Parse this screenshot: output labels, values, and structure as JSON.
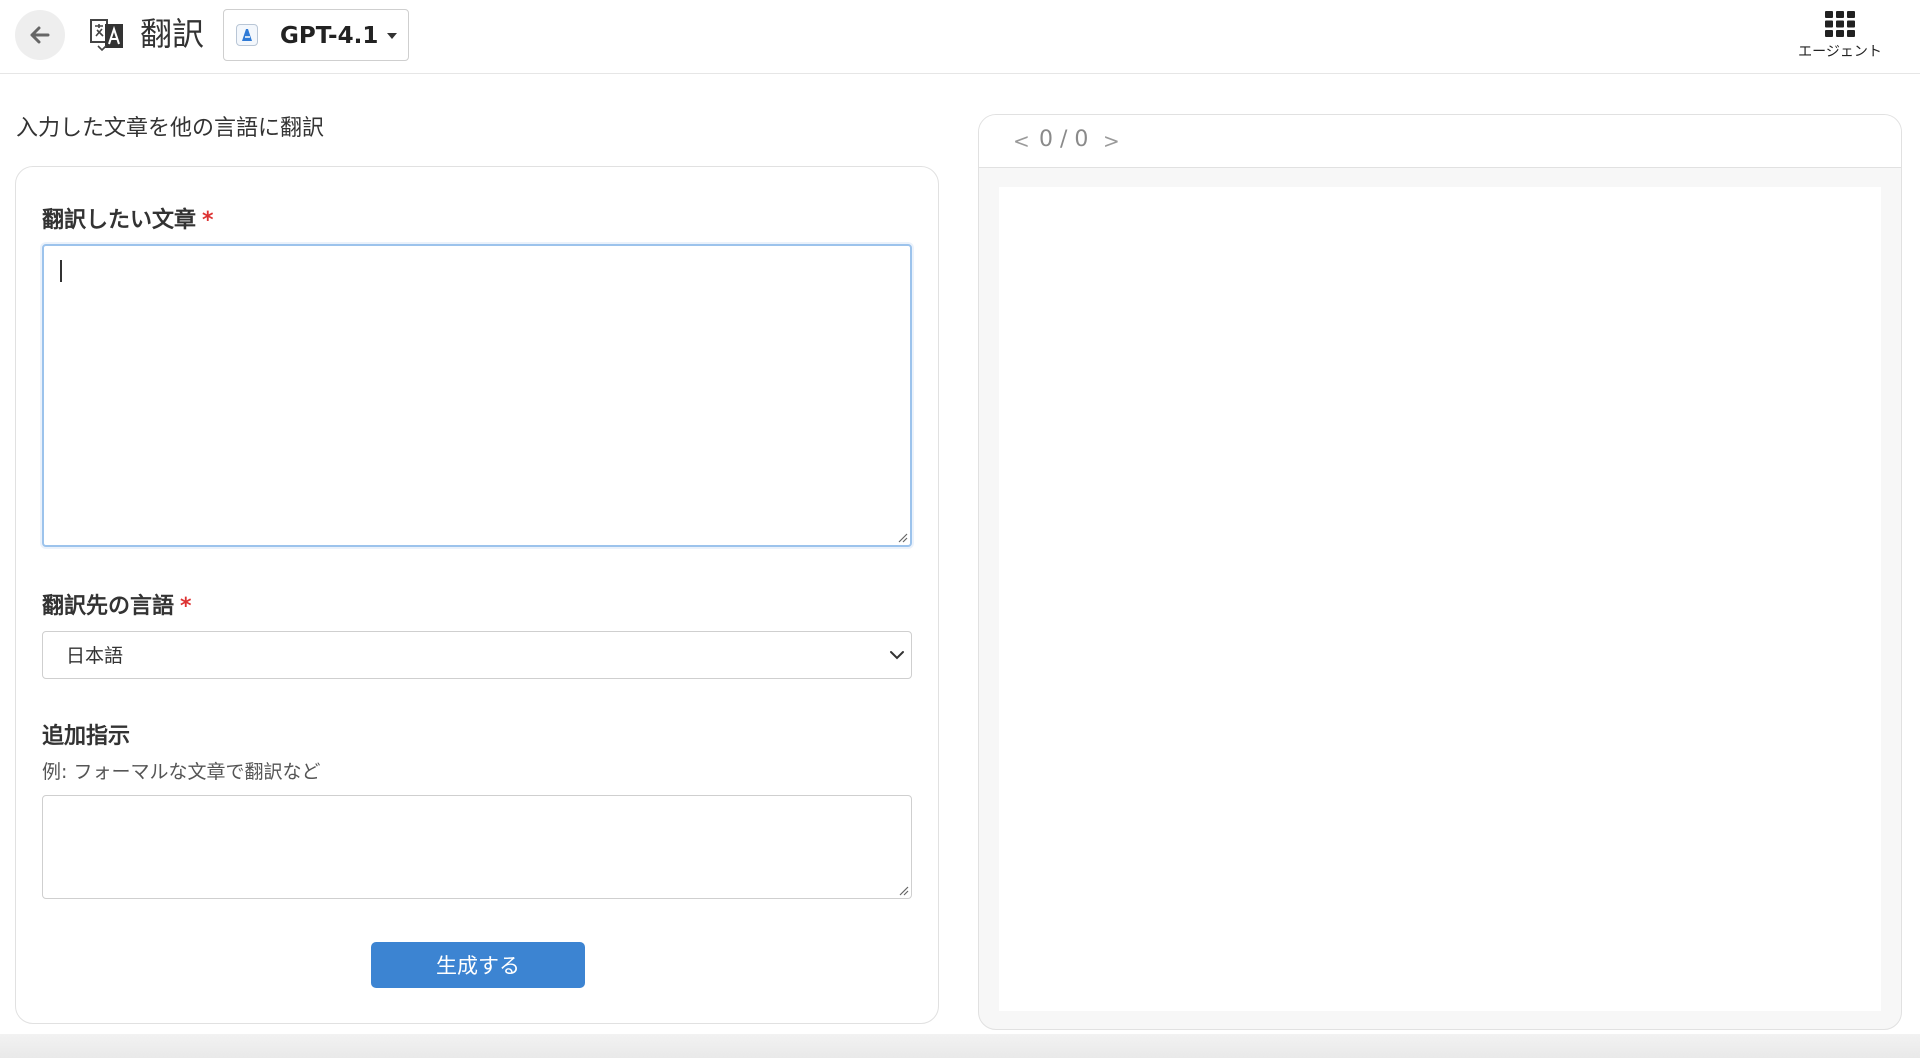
{
  "header": {
    "title": "翻訳",
    "model": "GPT-4.1",
    "agent_label": "エージェント"
  },
  "form": {
    "description": "入力した文章を他の言語に翻訳",
    "source_label": "翻訳したい文章",
    "required_mark": "*",
    "source_value": "",
    "target_label": "翻訳先の言語",
    "target_value": "日本語",
    "extra_label": "追加指示",
    "extra_hint": "例: フォーマルな文章で翻訳など",
    "extra_value": "",
    "generate_label": "生成する"
  },
  "result": {
    "prev": "<",
    "page_count": "0 / 0",
    "next": ">"
  },
  "colors": {
    "accent": "#3c84d2",
    "required": "#dd3333",
    "focus_border": "#9cc3ec"
  }
}
